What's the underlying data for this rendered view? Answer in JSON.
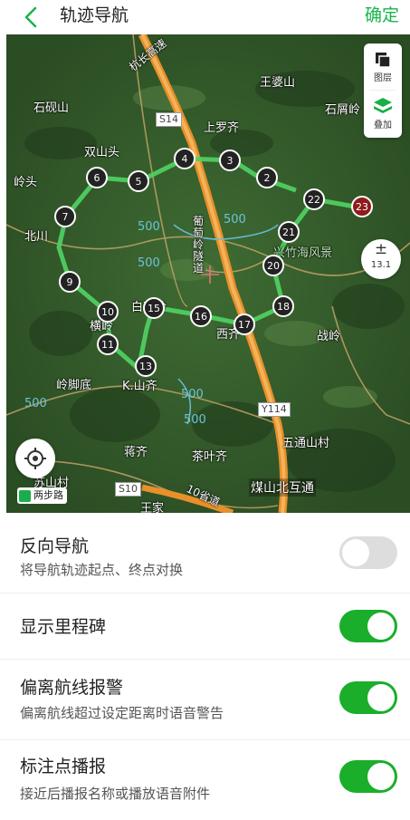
{
  "header": {
    "title": "轨迹导航",
    "confirm_label": "确定"
  },
  "map": {
    "poi_labels": [
      "王婆山",
      "石砚山",
      "石屑岭",
      "上罗齐",
      "双山头",
      "岭头",
      "北川",
      "白石岭",
      "横岭",
      "西齐",
      "战岭",
      "岭脚底",
      "K.山齐",
      "五通山村",
      "蒋齐",
      "茶叶齐",
      "苏山村",
      "王家",
      "兴竹海风景",
      "杭长高速",
      "葡萄岭隧道",
      "10省道"
    ],
    "road_badges": [
      "S14",
      "Y114",
      "S10"
    ],
    "elevation_labels": [
      "500",
      "500",
      "500",
      "500",
      "500",
      "500"
    ],
    "bottom_label": "煤山北互通",
    "waypoints": [
      "2",
      "3",
      "4",
      "5",
      "6",
      "7",
      "9",
      "10",
      "11",
      "13",
      "15",
      "16",
      "17",
      "18",
      "20",
      "21",
      "22",
      "23"
    ],
    "layers_label": "图层",
    "overlay_label": "叠加",
    "zoom_symbol": "±",
    "zoom_level": "13.1",
    "walk_badge": "两步路",
    "colors": {
      "track": "#4fd163",
      "accent": "#17b34a",
      "highway": "#e8902a",
      "end_marker": "#8e1c1c"
    }
  },
  "settings": [
    {
      "title": "反向导航",
      "desc": "将导航轨迹起点、终点对换",
      "enabled": false
    },
    {
      "title": "显示里程碑",
      "desc": "",
      "enabled": true
    },
    {
      "title": "偏离航线报警",
      "desc": "偏离航线超过设定距离时语音警告",
      "enabled": true
    },
    {
      "title": "标注点播报",
      "desc": "接近后播报名称或播放语音附件",
      "enabled": true
    }
  ]
}
